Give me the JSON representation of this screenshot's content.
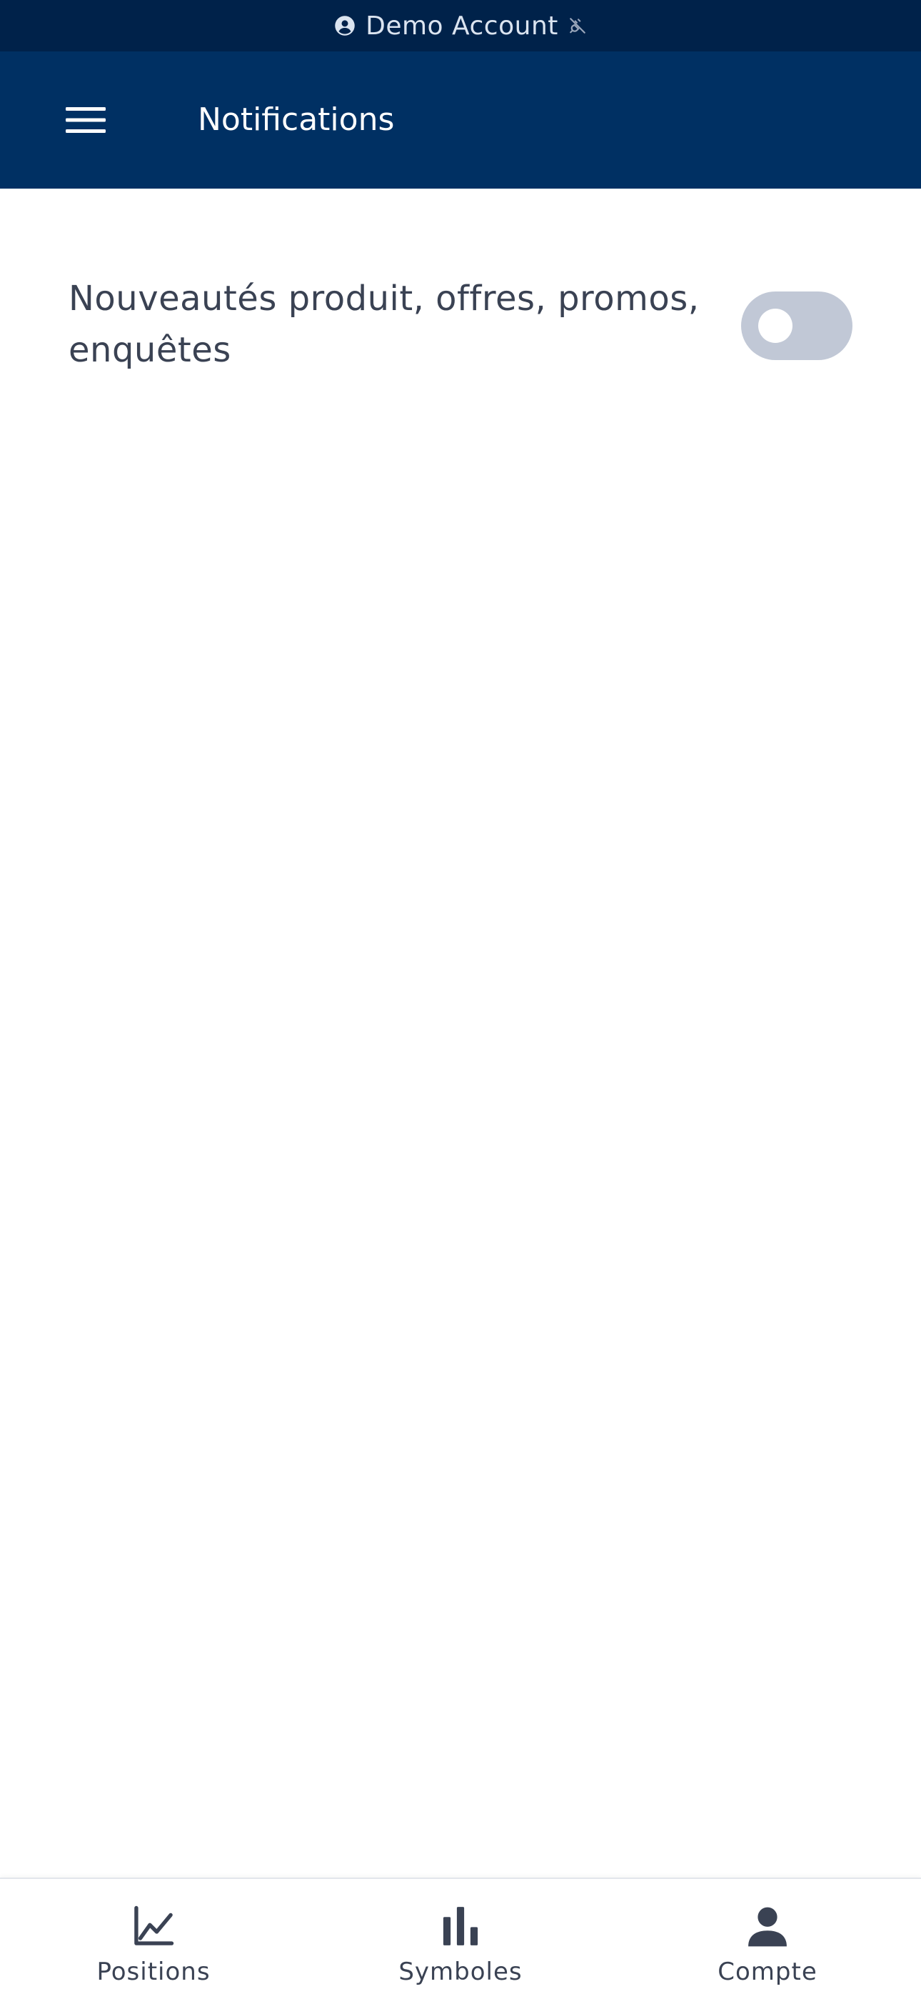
{
  "demo_bar": {
    "label": "Demo Account",
    "account_icon": "account-circle-icon",
    "status_icon": "plug-disconnected-icon",
    "text_color": "#dbe4f0",
    "background": "#00224a"
  },
  "header": {
    "title": "Notifications",
    "menu_icon": "hamburger-menu-icon",
    "background": "#003063"
  },
  "settings": [
    {
      "label": "Nouveautés produit, offres, promos, enquêtes",
      "enabled": false
    }
  ],
  "bottom_nav": {
    "items": [
      {
        "label": "Positions",
        "icon": "line-chart-icon"
      },
      {
        "label": "Symboles",
        "icon": "bar-chart-icon"
      },
      {
        "label": "Compte",
        "icon": "person-icon"
      }
    ]
  },
  "colors": {
    "text": "#3a4253",
    "toggle_off": "#c1c8d6"
  }
}
